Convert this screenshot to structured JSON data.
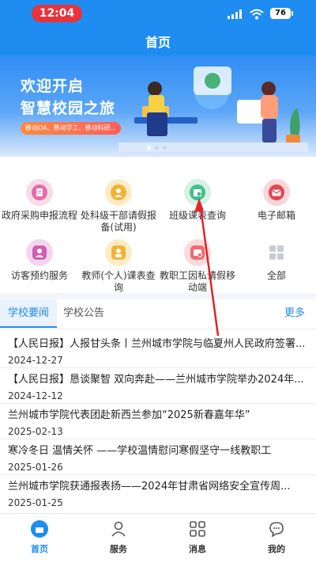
{
  "status_bar": {
    "time": "12:04",
    "battery": "76"
  },
  "header": {
    "title": "首页"
  },
  "banner": {
    "line1": "欢迎开启",
    "line2": "智慧校园之旅",
    "tag": "移动OA、移动学工、移动科研..."
  },
  "grid": {
    "items": [
      {
        "label": "政府采购申报流程",
        "color": "#e86aa9",
        "icon": "document-icon"
      },
      {
        "label": "处科级干部请假报备(试用)",
        "color": "#f2b233",
        "icon": "person-clock-icon"
      },
      {
        "label": "班级课表查询",
        "color": "#43c08a",
        "icon": "schedule-icon"
      },
      {
        "label": "电子邮箱",
        "color": "#e2454f",
        "icon": "mail-icon"
      },
      {
        "label": "访客预约服务",
        "color": "#d25cb6",
        "icon": "visitor-icon"
      },
      {
        "label": "教师(个人)课表查询",
        "color": "#f2b233",
        "icon": "teacher-schedule-icon"
      },
      {
        "label": "教职工因私请假移动端",
        "color": "#ee6a6f",
        "icon": "leave-icon"
      },
      {
        "label": "全部",
        "color": "#c9ccd3",
        "icon": "grid-icon"
      }
    ]
  },
  "news": {
    "tabs": [
      "学校要闻",
      "学校公告"
    ],
    "more": "更多",
    "items": [
      {
        "title": "【人民日报】人报甘头条丨兰州城市学院与临夏州人民政府签署...",
        "date": "2024-12-27"
      },
      {
        "title": "【人民日报】恳谈聚智 双向奔赴——兰州城市学院举办2024年...",
        "date": "2024-12-12"
      },
      {
        "title": "兰州城市学院代表团赴新西兰参加“2025新春嘉年华”",
        "date": "2025-02-13"
      },
      {
        "title": "寒冷冬日 温情关怀 ——学校温情慰问寒假坚守一线教职工",
        "date": "2025-01-26"
      },
      {
        "title": "兰州城市学院获通报表扬——2024年甘肃省网络安全宣传周...",
        "date": "2025-01-25"
      }
    ]
  },
  "tabbar": {
    "items": [
      {
        "label": "首页",
        "icon": "home-icon"
      },
      {
        "label": "服务",
        "icon": "service-icon"
      },
      {
        "label": "消息",
        "icon": "message-grid-icon"
      },
      {
        "label": "我的",
        "icon": "profile-chat-icon"
      }
    ]
  },
  "colors": {
    "primary": "#1e8cf0",
    "alert": "#e8333a"
  }
}
